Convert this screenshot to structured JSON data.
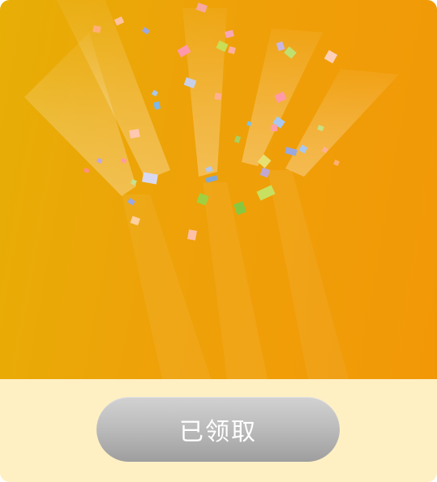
{
  "button": {
    "label": "已领取"
  },
  "colors": {
    "banner_left": "#E7AE06",
    "banner_right": "#F29807",
    "footer_bg": "#FFF0C4",
    "button_top": "#D2D2D2",
    "button_bottom": "#9E9E9E",
    "button_text": "#FFFFFF"
  }
}
